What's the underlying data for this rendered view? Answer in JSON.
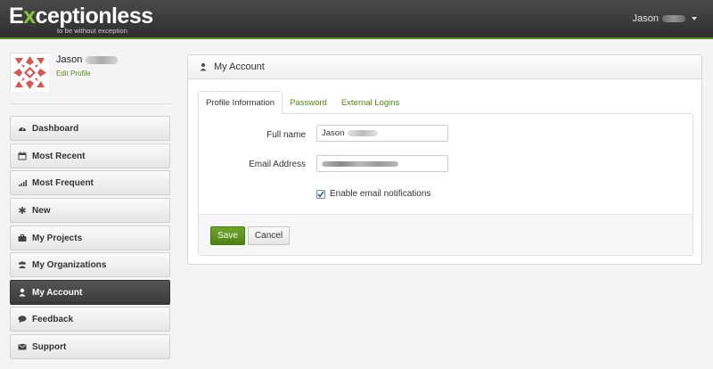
{
  "brand": {
    "logo_prefix": "E",
    "logo_x": "x",
    "logo_rest": "ceptionless",
    "tagline": "to be without exception",
    "accent_color": "#5e8e1a"
  },
  "header": {
    "user_name": "Jason"
  },
  "profile": {
    "name": "Jason",
    "edit_label": "Edit Profile"
  },
  "sidebar": {
    "items": [
      {
        "label": "Dashboard",
        "icon": "dashboard-icon",
        "active": false
      },
      {
        "label": "Most Recent",
        "icon": "calendar-icon",
        "active": false
      },
      {
        "label": "Most Frequent",
        "icon": "signal-bars-icon",
        "active": false
      },
      {
        "label": "New",
        "icon": "asterisk-icon",
        "active": false
      },
      {
        "label": "My Projects",
        "icon": "briefcase-icon",
        "active": false
      },
      {
        "label": "My Organizations",
        "icon": "group-icon",
        "active": false
      },
      {
        "label": "My Account",
        "icon": "user-icon",
        "active": true
      },
      {
        "label": "Feedback",
        "icon": "comment-icon",
        "active": false
      },
      {
        "label": "Support",
        "icon": "envelope-icon",
        "active": false
      }
    ]
  },
  "panel": {
    "title": "My Account",
    "tabs": [
      {
        "label": "Profile Information",
        "active": true
      },
      {
        "label": "Password",
        "active": false
      },
      {
        "label": "External Logins",
        "active": false
      }
    ],
    "form": {
      "full_name_label": "Full name",
      "full_name_value": "Jason",
      "email_label": "Email Address",
      "notifications_label": "Enable email notifications",
      "notifications_checked": true
    },
    "save_label": "Save",
    "cancel_label": "Cancel"
  }
}
